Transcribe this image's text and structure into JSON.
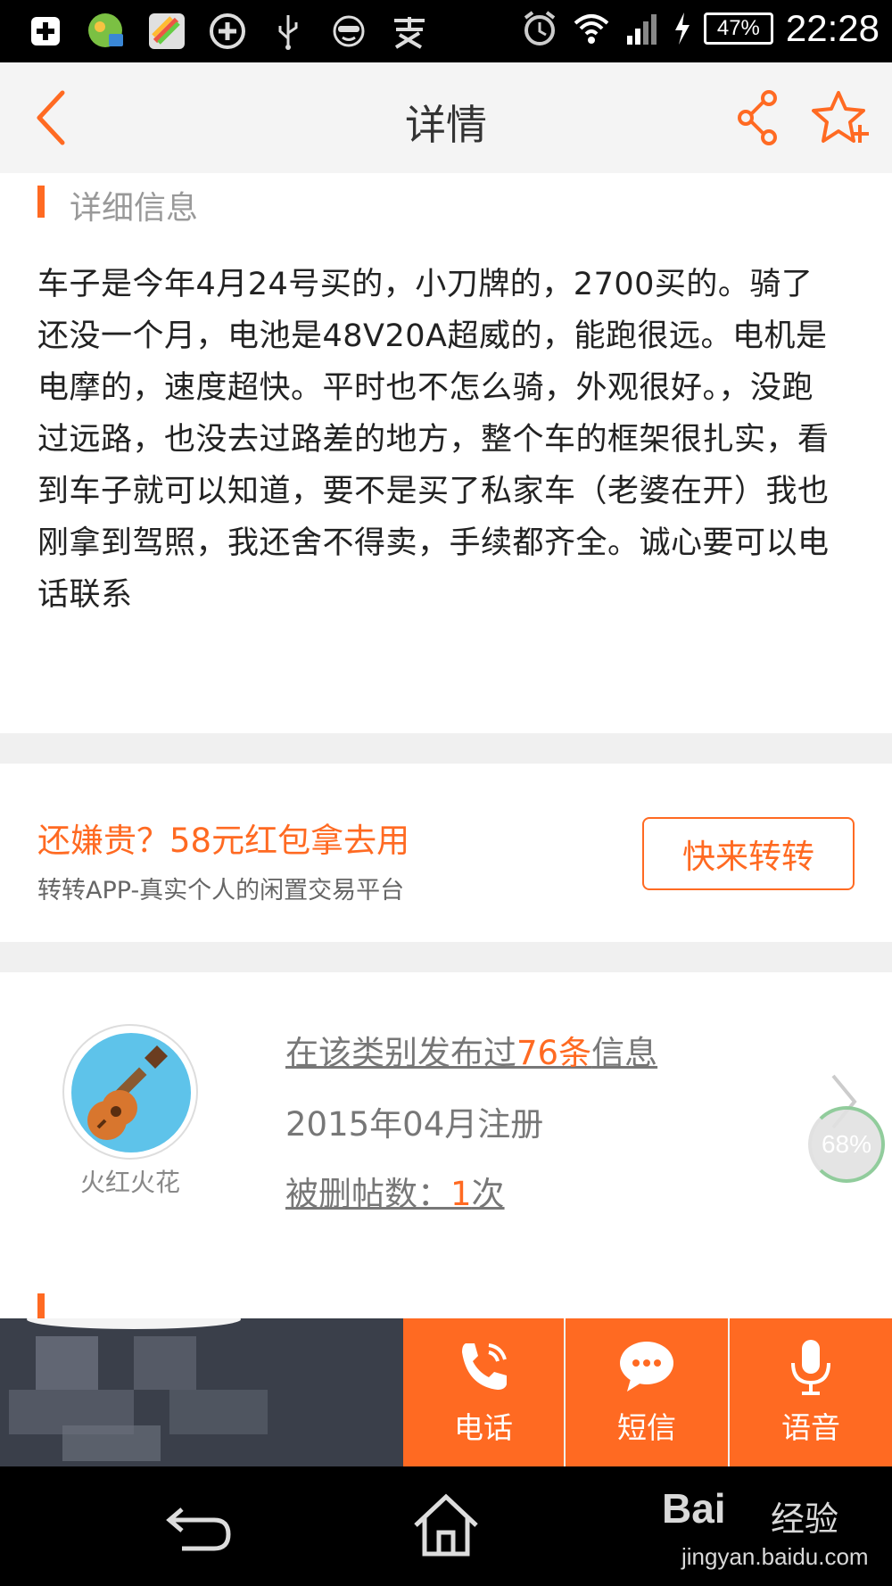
{
  "status_bar": {
    "time": "22:28",
    "battery": "47%"
  },
  "header": {
    "title": "详情"
  },
  "detail": {
    "section_title": "详细信息",
    "description": "车子是今年4月24号买的，小刀牌的，2700买的。骑了还没一个月，电池是48V20A超威的，能跑很远。电机是电摩的，速度超快。平时也不怎么骑，外观很好。，没跑过远路，也没去过路差的地方，整个车的框架很扎实，看到车子就可以知道，要不是买了私家车（老婆在开）我也刚拿到驾照，我还舍不得卖，手续都齐全。诚心要可以电话联系"
  },
  "promo": {
    "title": "还嫌贵？58元红包拿去用",
    "subtitle": "转转APP-真实个人的闲置交易平台",
    "button": "快来转转"
  },
  "seller": {
    "name": "火红火花",
    "posts_prefix": "在该类别发布过",
    "posts_count": "76条",
    "posts_suffix": "信息",
    "registered": "2015年04月注册",
    "deleted_prefix": "被删帖数：",
    "deleted_count": "1",
    "deleted_suffix": "次",
    "float_percent": "68%"
  },
  "actions": {
    "call": "电话",
    "sms": "短信",
    "voice": "语音"
  },
  "watermark": {
    "brand_a": "Bai",
    "brand_b": "经验",
    "url": "jingyan.baidu.com"
  },
  "colors": {
    "accent": "#ff6a22",
    "avatar_bg": "#5ec3ea",
    "dark_zone": "#3a3f4a"
  }
}
